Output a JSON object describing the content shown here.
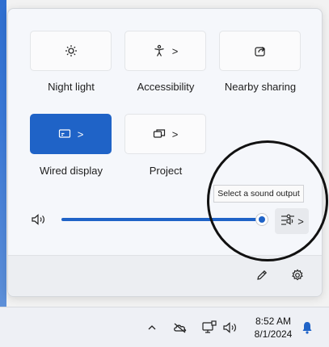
{
  "tiles": [
    {
      "label": "Night light",
      "icon": "brightness-icon",
      "active": false,
      "has_chevron": false
    },
    {
      "label": "Accessibility",
      "icon": "accessibility-icon",
      "active": false,
      "has_chevron": true
    },
    {
      "label": "Nearby sharing",
      "icon": "share-icon",
      "active": false,
      "has_chevron": false
    },
    {
      "label": "Wired display",
      "icon": "cast-icon",
      "active": true,
      "has_chevron": true
    },
    {
      "label": "Project",
      "icon": "project-icon",
      "active": false,
      "has_chevron": true
    }
  ],
  "chevron": ">",
  "volume": {
    "level_percent": 98,
    "icon": "speaker-icon"
  },
  "tooltip": "Select a sound output",
  "footer": {
    "edit_icon": "pencil-icon",
    "settings_icon": "gear-icon"
  },
  "taskbar": {
    "time": "8:52 AM",
    "date": "8/1/2024",
    "icons": [
      "chevron-up-icon",
      "onedrive-icon",
      "network-icon",
      "speaker-icon",
      "notification-bell-icon"
    ]
  },
  "colors": {
    "accent": "#1f63c7",
    "panel": "#f5f7fb",
    "taskbar": "#eef0f5"
  }
}
